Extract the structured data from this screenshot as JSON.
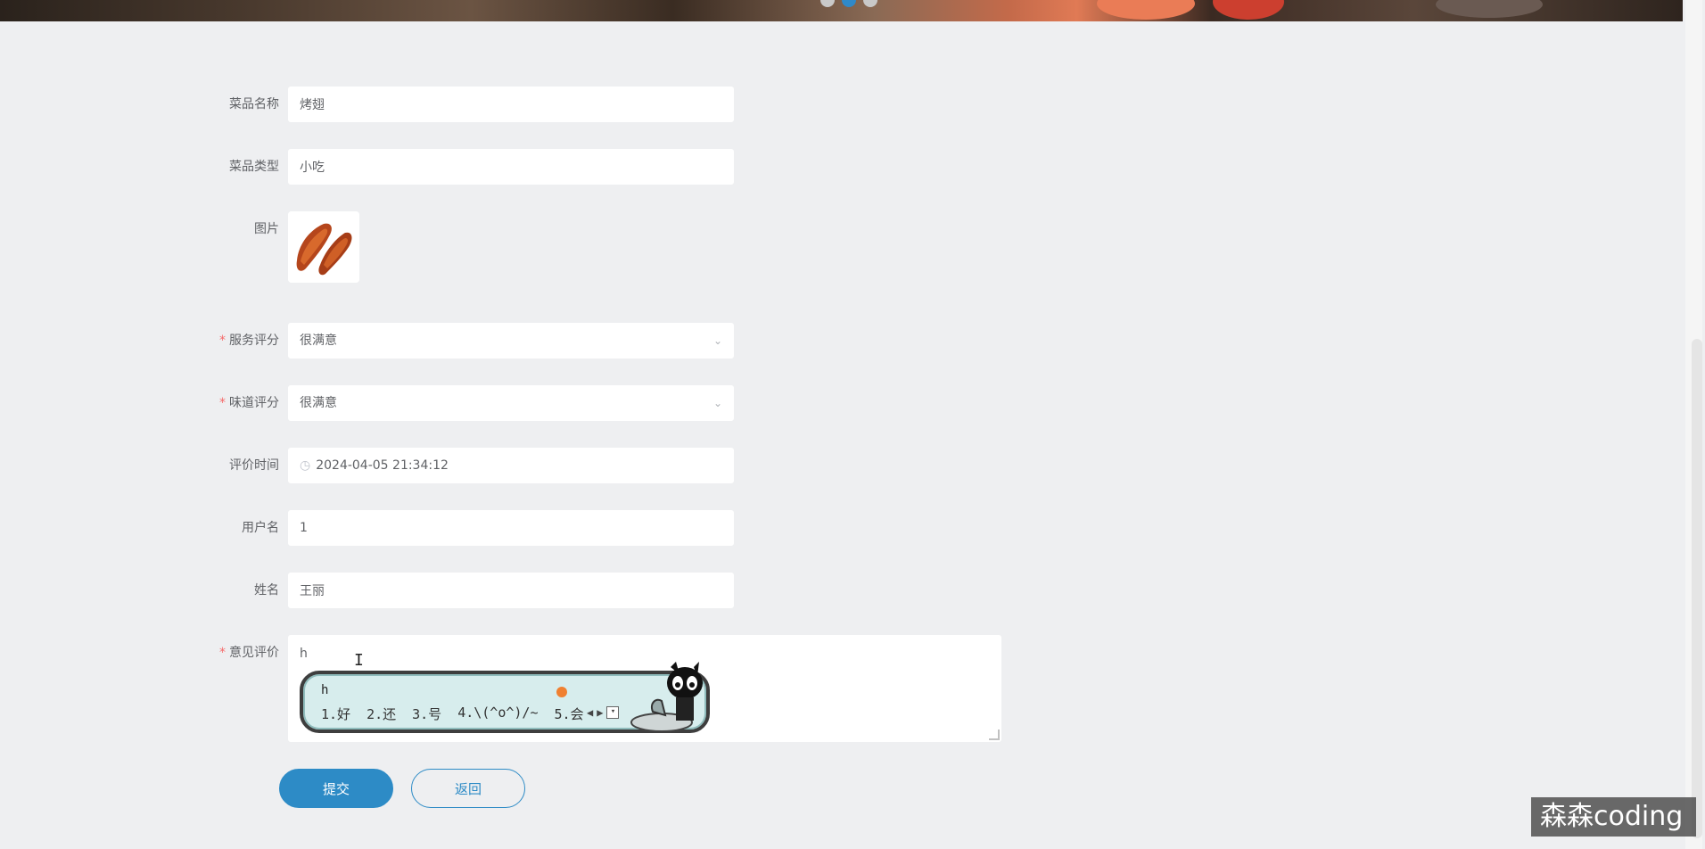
{
  "carousel": {
    "dot_count": 3,
    "active_index": 1
  },
  "form": {
    "dish_name": {
      "label": "菜品名称",
      "value": "烤翅"
    },
    "dish_type": {
      "label": "菜品类型",
      "value": "小吃"
    },
    "image": {
      "label": "图片"
    },
    "service_rating": {
      "label": "服务评分",
      "value": "很满意",
      "required": true
    },
    "taste_rating": {
      "label": "味道评分",
      "value": "很满意",
      "required": true
    },
    "review_time": {
      "label": "评价时间",
      "value": "2024-04-05 21:34:12"
    },
    "username": {
      "label": "用户名",
      "value": "1"
    },
    "name": {
      "label": "姓名",
      "value": "王丽"
    },
    "comment": {
      "label": "意见评价",
      "value": "h",
      "required": true
    }
  },
  "ime": {
    "composition": "h",
    "candidates": [
      "1.好",
      "2.还",
      "3.号",
      "4.\\(^o^)/~",
      "5.会"
    ]
  },
  "buttons": {
    "submit": "提交",
    "back": "返回"
  },
  "watermark": "森森coding",
  "colors": {
    "accent": "#2d8bc6",
    "required": "#f56c6c",
    "background": "#eeeff1"
  }
}
